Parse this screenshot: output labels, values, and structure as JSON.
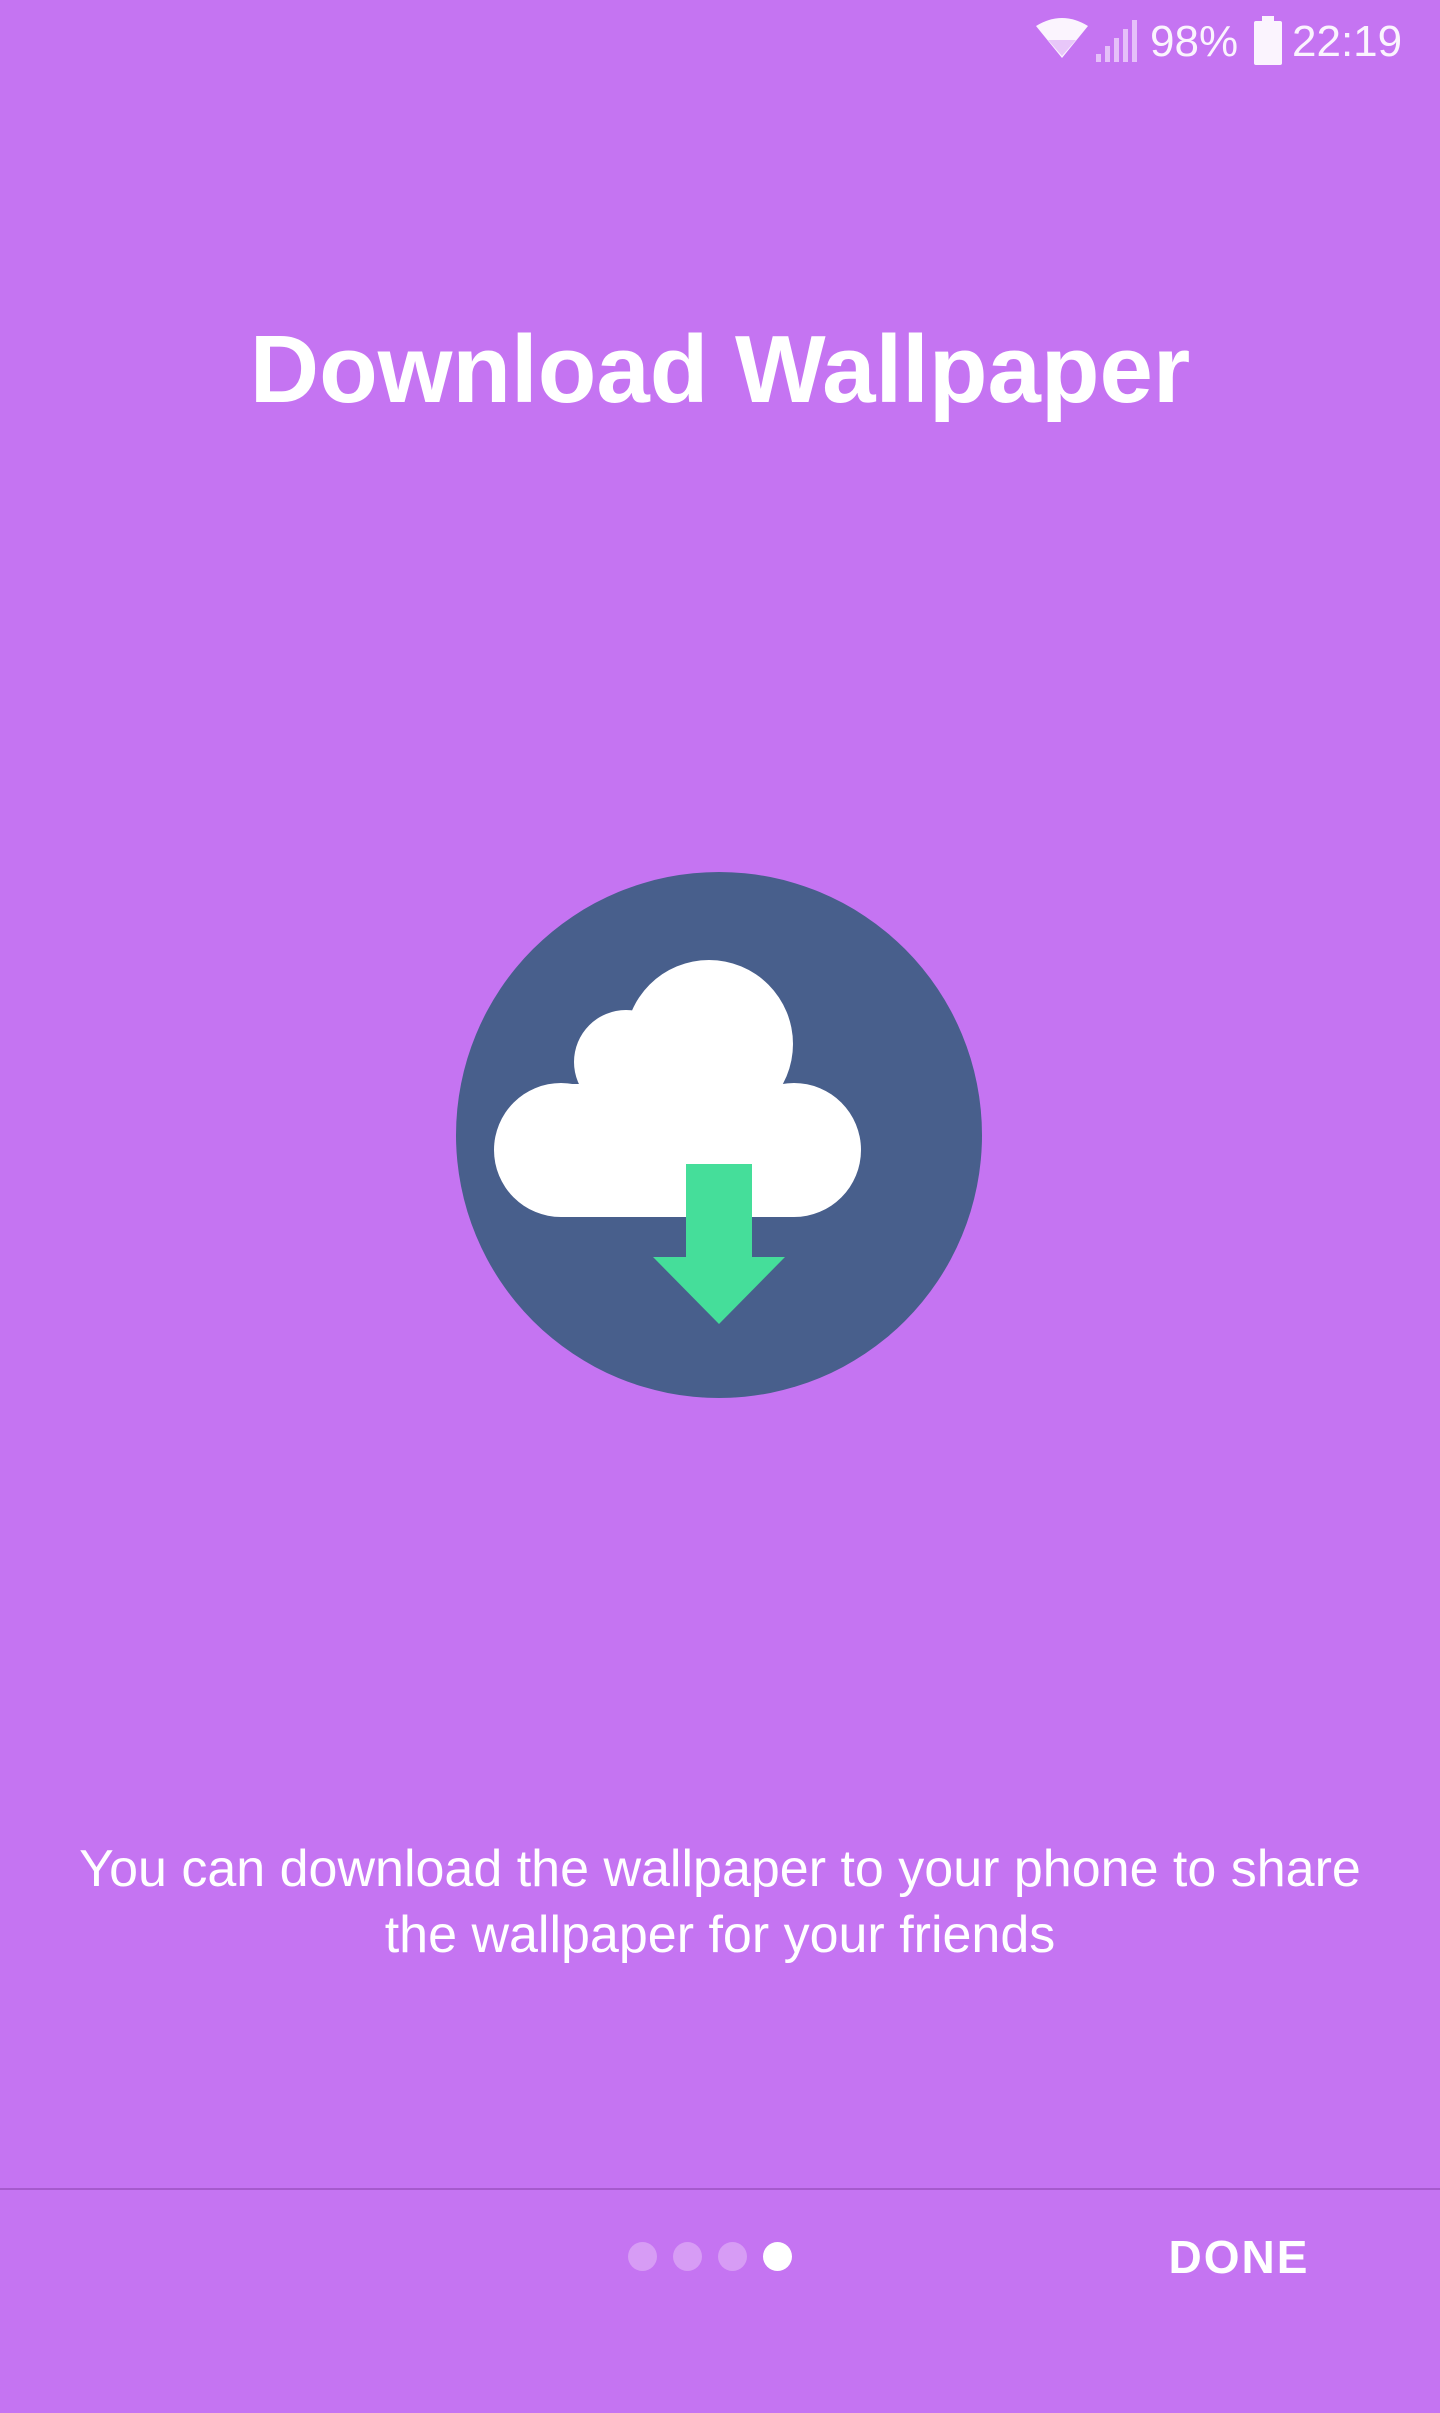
{
  "colors": {
    "background": "#C574F2",
    "circle": "#485F8C",
    "cloud": "#FFFFFF",
    "arrow": "#45DE9A",
    "divider": "#A65ACD",
    "dot_active": "#FFFFFF",
    "dot_inactive": "#D79CF5"
  },
  "status_bar": {
    "wifi_icon": "wifi-icon",
    "signal_icon": "signal-icon",
    "battery_percent": "98%",
    "battery_icon": "battery-icon",
    "time": "22:19"
  },
  "onboarding": {
    "title": "Download Wallpaper",
    "illustration_icon": "cloud-download-icon",
    "description": "You can download the wallpaper to your phone to share the wallpaper for your friends"
  },
  "pager": {
    "total_pages": 4,
    "current_page": 4
  },
  "footer": {
    "done_label": "DONE"
  }
}
